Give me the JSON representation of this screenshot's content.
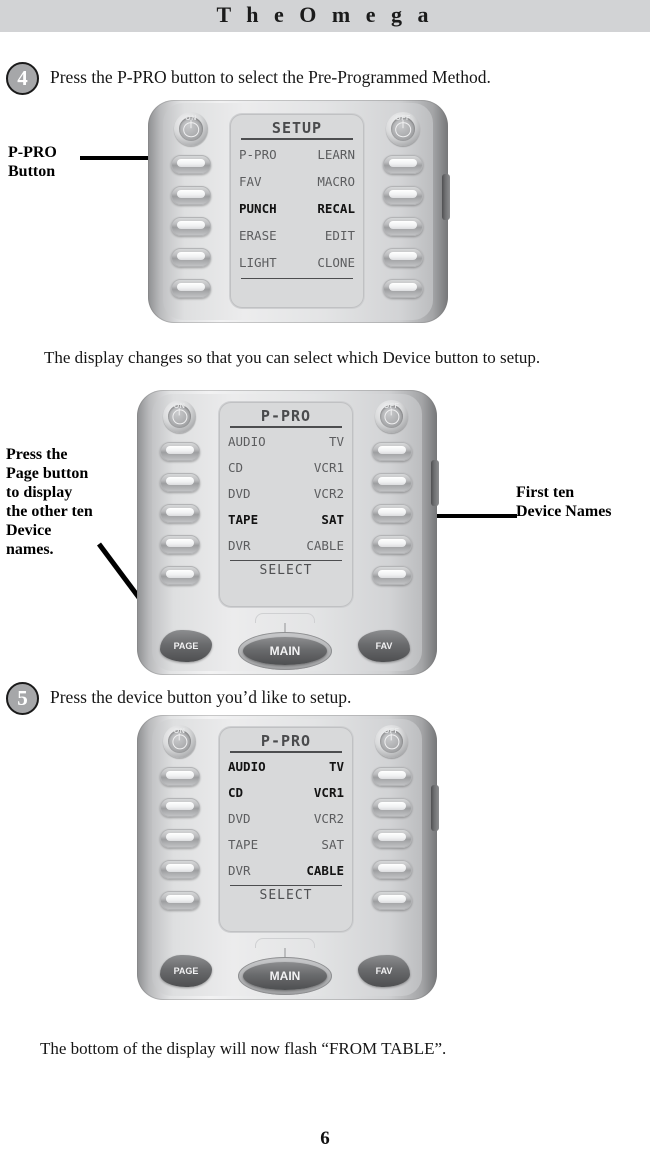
{
  "header": {
    "title": "T h e   O m e g a"
  },
  "steps": [
    {
      "number": "4",
      "text": "Press the P-PRO button to select the Pre-Programmed Method."
    },
    {
      "number": "5",
      "text": "Press the device button you’d like to setup."
    }
  ],
  "paragraphs": {
    "after_step4": "The display changes so that you can select which Device button to setup.",
    "closing": "The bottom of the display will now flash “FROM TABLE”."
  },
  "callouts": {
    "p_pro_button": "P-PRO\nButton",
    "page_button": "Press the\nPage button\nto display\nthe other ten\nDevice\nnames.",
    "first_ten": "First ten\nDevice Names"
  },
  "remotes": [
    {
      "id": "remote-setup",
      "lcd": {
        "title": "SETUP",
        "rows": [
          {
            "left": "P-PRO",
            "right": "LEARN",
            "left_bold": false,
            "right_bold": false
          },
          {
            "left": "FAV",
            "right": "MACRO",
            "left_bold": false,
            "right_bold": false
          },
          {
            "left": "PUNCH",
            "right": "RECAL",
            "left_bold": true,
            "right_bold": true
          },
          {
            "left": "ERASE",
            "right": "EDIT",
            "left_bold": false,
            "right_bold": false
          },
          {
            "left": "LIGHT",
            "right": "CLONE",
            "left_bold": false,
            "right_bold": false
          }
        ],
        "footer": ""
      },
      "keys": {
        "on": "ON",
        "off": "OFF"
      },
      "bottom_keys": []
    },
    {
      "id": "remote-ppro-page1",
      "lcd": {
        "title": "P-PRO",
        "rows": [
          {
            "left": "AUDIO",
            "right": "TV",
            "left_bold": false,
            "right_bold": false
          },
          {
            "left": "CD",
            "right": "VCR1",
            "left_bold": false,
            "right_bold": false
          },
          {
            "left": "DVD",
            "right": "VCR2",
            "left_bold": false,
            "right_bold": false
          },
          {
            "left": "TAPE",
            "right": "SAT",
            "left_bold": true,
            "right_bold": true
          },
          {
            "left": "DVR",
            "right": "CABLE",
            "left_bold": false,
            "right_bold": false
          }
        ],
        "footer": "SELECT"
      },
      "keys": {
        "on": "ON",
        "off": "OFF"
      },
      "bottom_keys": {
        "page": "PAGE",
        "main": "MAIN",
        "fav": "FAV"
      }
    },
    {
      "id": "remote-ppro-selected",
      "lcd": {
        "title": "P-PRO",
        "rows": [
          {
            "left": "AUDIO",
            "right": "TV",
            "left_bold": true,
            "right_bold": true
          },
          {
            "left": "CD",
            "right": "VCR1",
            "left_bold": true,
            "right_bold": true
          },
          {
            "left": "DVD",
            "right": "VCR2",
            "left_bold": false,
            "right_bold": false
          },
          {
            "left": "TAPE",
            "right": "SAT",
            "left_bold": false,
            "right_bold": false
          },
          {
            "left": "DVR",
            "right": "CABLE",
            "left_bold": false,
            "right_bold": true
          }
        ],
        "footer": "SELECT"
      },
      "keys": {
        "on": "ON",
        "off": "OFF"
      },
      "bottom_keys": {
        "page": "PAGE",
        "main": "MAIN",
        "fav": "FAV"
      }
    }
  ],
  "page_number": "6",
  "colors": {
    "header_bg": "#d2d3d5",
    "text": "#161616",
    "lcd_bg": "#d8d9da",
    "lcd_text": "#5c5d5f",
    "lcd_text_bold": "#131313",
    "dark_key": "#5a5b5d"
  }
}
